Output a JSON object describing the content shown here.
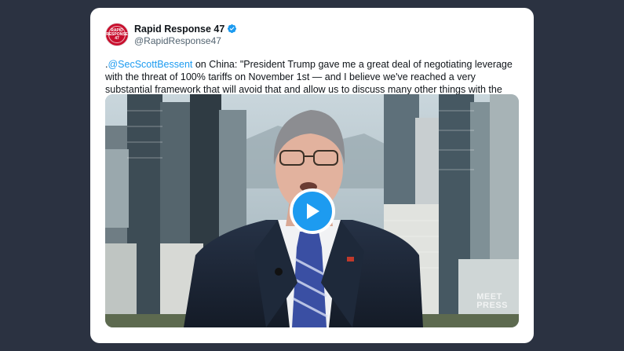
{
  "tweet": {
    "display_name": "Rapid Response 47",
    "handle": "@RapidResponse47",
    "avatar_text": "RAPID RESPONSE 47",
    "text_prefix": ".",
    "mention": "@SecScottBessent",
    "text_body": " on China: \"President Trump gave me a great deal of negotiating leverage with the threat of 100% tariffs on November 1st — and I believe we've reached a very substantial framework that will avoid that and allow us to discuss many other things with the Chinese.\""
  },
  "video": {
    "watermark_line1": "MEET",
    "watermark_line2": "PRESS",
    "play_icon": "play-icon"
  },
  "colors": {
    "background": "#2b3241",
    "card": "#ffffff",
    "accent": "#1d9bf0",
    "avatar": "#c8102e"
  }
}
